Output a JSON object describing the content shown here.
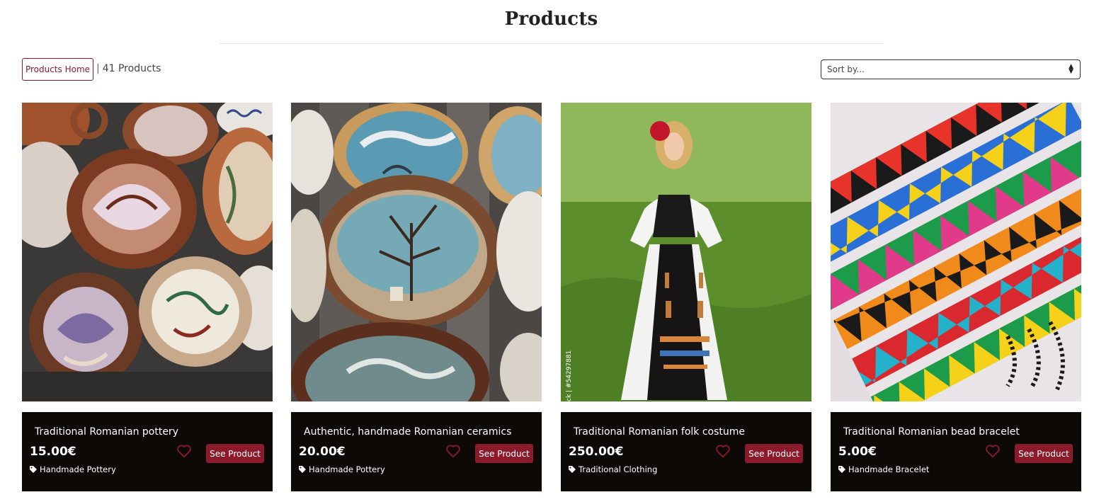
{
  "header": {
    "title": "Products"
  },
  "toolbar": {
    "home_label": "Products Home",
    "separator": "|",
    "count_text": "41 Products",
    "sort_placeholder": "Sort by..."
  },
  "colors": {
    "accent": "#8b1a2b",
    "card_bg": "#0c0907",
    "text": "#222222"
  },
  "products": [
    {
      "title": "Traditional Romanian pottery",
      "price": "15.00€",
      "category": "Handmade Pottery",
      "button": "See Product",
      "image": "swirled-clay-plates-photo"
    },
    {
      "title": "Authentic, handmade Romanian ceramics",
      "price": "20.00€",
      "category": "Handmade Pottery",
      "button": "See Product",
      "image": "painted-blue-bowls-photo"
    },
    {
      "title": "Traditional Romanian folk costume",
      "price": "250.00€",
      "category": "Traditional Clothing",
      "button": "See Product",
      "image": "woman-folk-costume-photo",
      "watermark": "ck | #54297881"
    },
    {
      "title": "Traditional Romanian bead bracelet",
      "price": "5.00€",
      "category": "Handmade Bracelet",
      "button": "See Product",
      "image": "beaded-bracelets-photo"
    }
  ],
  "icons": {
    "tag": "tag-icon",
    "favorite": "heart-outline-icon",
    "sort": "sort-arrows-icon"
  }
}
